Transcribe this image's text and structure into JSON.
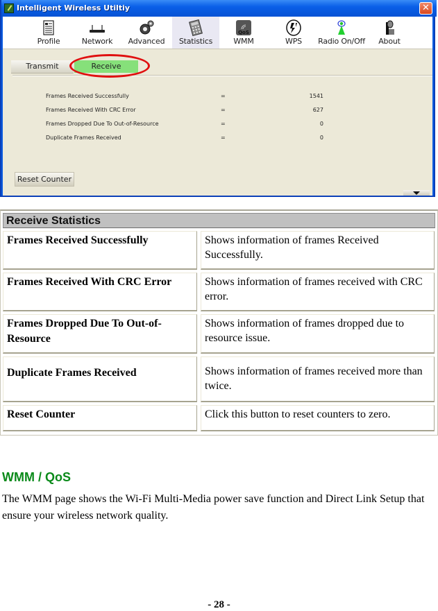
{
  "window": {
    "title": "Intelligent Wireless Utiltiy",
    "close_label": "✕"
  },
  "toolbar": {
    "items": [
      {
        "label": "Profile",
        "icon": "profile-icon",
        "active": false
      },
      {
        "label": "Network",
        "icon": "network-icon",
        "active": false
      },
      {
        "label": "Advanced",
        "icon": "advanced-icon",
        "active": false
      },
      {
        "label": "Statistics",
        "icon": "statistics-icon",
        "active": true
      },
      {
        "label": "WMM",
        "icon": "wmm-qos-icon",
        "active": false
      },
      {
        "label": "WPS",
        "icon": "wps-icon",
        "active": false
      },
      {
        "label": "Radio On/Off",
        "icon": "radio-icon",
        "active": false
      },
      {
        "label": "About",
        "icon": "about-icon",
        "active": false
      }
    ]
  },
  "tabs": {
    "transmit": "Transmit",
    "receive": "Receive",
    "active": "Receive"
  },
  "stats": [
    {
      "name": "Frames Received Successfully",
      "eq": "=",
      "value": "1541"
    },
    {
      "name": "Frames Received With CRC Error",
      "eq": "=",
      "value": "627"
    },
    {
      "name": "Frames Dropped Due To Out-of-Resource",
      "eq": "=",
      "value": "0"
    },
    {
      "name": "Duplicate Frames Received",
      "eq": "=",
      "value": "0"
    }
  ],
  "reset_button": "Reset Counter",
  "doc_table": {
    "header": "Receive Statistics",
    "rows": [
      {
        "term": "Frames Received Successfully",
        "desc": "Shows information of frames Received Successfully."
      },
      {
        "term": "Frames Received With CRC Error",
        "desc": "Shows information of frames received with CRC error."
      },
      {
        "term": "Frames Dropped Due To Out-of-Resource",
        "desc": "Shows information of frames dropped due to resource issue."
      },
      {
        "term": "Duplicate Frames Received",
        "desc": "Shows information of frames received more than twice."
      },
      {
        "term": "Reset Counter",
        "desc": "Click this button to reset counters to zero."
      }
    ]
  },
  "section": {
    "title": "WMM / QoS",
    "paragraph": "The WMM page shows the Wi-Fi Multi-Media power save function and Direct Link Setup that ensure your wireless network quality."
  },
  "page_number": "- 28 -",
  "colors": {
    "active_tab": "#86e07a",
    "highlight": "#e01010",
    "section_title": "#0a8a1a",
    "titlebar": "#0a5fe8"
  }
}
